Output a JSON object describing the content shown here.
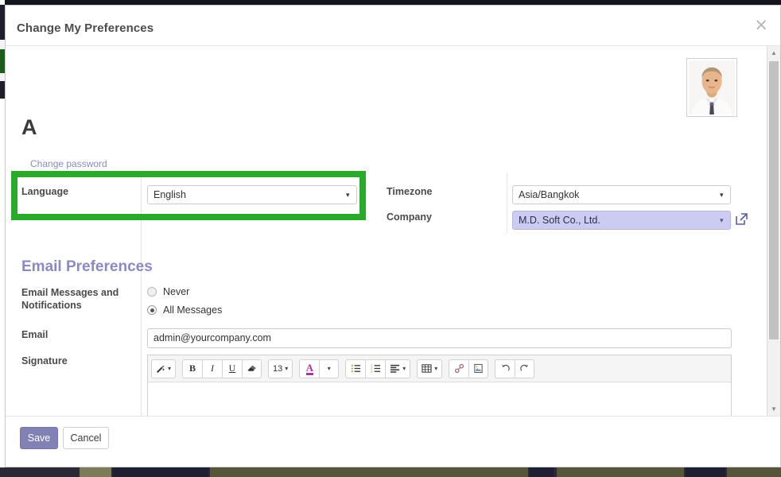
{
  "window": {
    "title": "Change My Preferences",
    "close_icon": "close-icon",
    "close_glyph": "×"
  },
  "user": {
    "display_name": "A",
    "change_password_label": "Change password",
    "avatar_alt": "user-avatar-photo"
  },
  "highlight": {
    "color": "#2aaa2a",
    "target": "language-field-row"
  },
  "fields": {
    "language": {
      "label": "Language",
      "value": "English",
      "caret": "▾"
    },
    "timezone": {
      "label": "Timezone",
      "value": "Asia/Bangkok",
      "caret": "▾"
    },
    "company": {
      "label": "Company",
      "value": "M.D. Soft Co., Ltd.",
      "caret": "▾",
      "highlight_color": "#ccccf2",
      "external_link_icon": "external-link-icon"
    }
  },
  "email_preferences": {
    "section_title": "Email Preferences",
    "notifications": {
      "label": "Email Messages and Notifications",
      "options": [
        {
          "label": "Never",
          "selected": false
        },
        {
          "label": "All Messages",
          "selected": true
        }
      ]
    },
    "email": {
      "label": "Email",
      "value": "admin@yourcompany.com"
    },
    "signature": {
      "label": "Signature",
      "content": "",
      "toolbar": {
        "groups": [
          {
            "buttons": [
              {
                "name": "style-magic-wand-icon",
                "glyph": "✒",
                "caret": true
              }
            ]
          },
          {
            "buttons": [
              {
                "name": "bold-button",
                "glyph": "B",
                "style": "tb-b"
              },
              {
                "name": "italic-button",
                "glyph": "I",
                "style": "tb-i"
              },
              {
                "name": "underline-button",
                "glyph": "U",
                "style": "tb-u"
              },
              {
                "name": "clear-format-eraser-icon",
                "glyph": "◢"
              }
            ]
          },
          {
            "buttons": [
              {
                "name": "font-size-button",
                "glyph": "13",
                "style": "tb-size",
                "caret": true
              }
            ]
          },
          {
            "buttons": [
              {
                "name": "text-color-button",
                "glyph": "A",
                "style": "tb-colorA",
                "color": "#b12fa0"
              },
              {
                "name": "color-dropdown-button",
                "glyph": "",
                "caret": true
              }
            ]
          },
          {
            "buttons": [
              {
                "name": "unordered-list-icon",
                "glyph": "☰"
              },
              {
                "name": "ordered-list-icon",
                "glyph": "☲"
              },
              {
                "name": "align-dropdown-icon",
                "glyph": "≡",
                "caret": true
              }
            ]
          },
          {
            "buttons": [
              {
                "name": "table-icon",
                "glyph": "⊞",
                "caret": true
              }
            ]
          },
          {
            "buttons": [
              {
                "name": "link-icon",
                "glyph": "ὑ7"
              },
              {
                "name": "image-icon",
                "glyph": "Ὓc"
              }
            ]
          },
          {
            "buttons": [
              {
                "name": "undo-icon",
                "glyph": "↺"
              },
              {
                "name": "redo-icon",
                "glyph": "↻"
              }
            ]
          }
        ]
      }
    }
  },
  "footer": {
    "save_label": "Save",
    "cancel_label": "Cancel",
    "save_color": "#8181b5"
  },
  "scrollbar": {
    "up_glyph": "▲",
    "down_glyph": "▼"
  }
}
